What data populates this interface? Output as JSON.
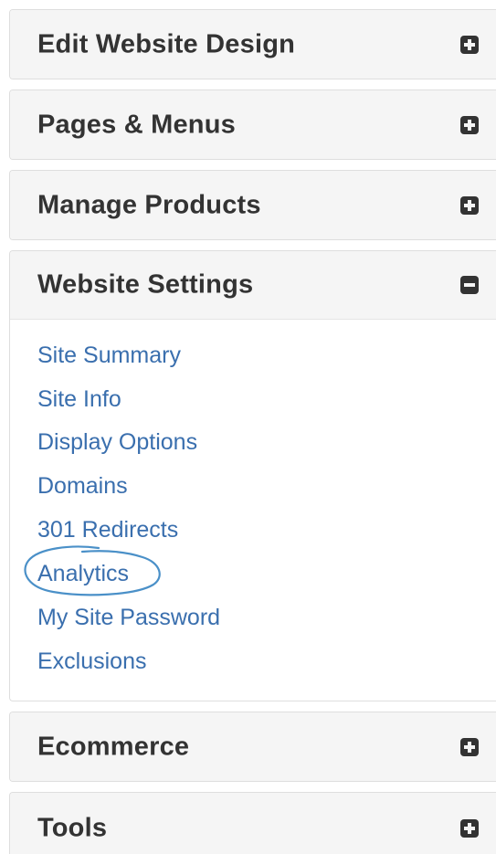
{
  "sections": [
    {
      "title": "Edit Website Design",
      "state": "collapsed",
      "icon": "plus-square-icon"
    },
    {
      "title": "Pages & Menus",
      "state": "collapsed",
      "icon": "plus-square-icon"
    },
    {
      "title": "Manage Products",
      "state": "collapsed",
      "icon": "plus-square-icon"
    },
    {
      "title": "Website Settings",
      "state": "expanded",
      "icon": "minus-square-icon",
      "links": [
        "Site Summary",
        "Site Info",
        "Display Options",
        "Domains",
        "301 Redirects",
        "Analytics",
        "My Site Password",
        "Exclusions"
      ]
    },
    {
      "title": "Ecommerce",
      "state": "collapsed",
      "icon": "plus-square-icon"
    },
    {
      "title": "Tools",
      "state": "collapsed",
      "icon": "plus-square-icon"
    }
  ],
  "annotation": {
    "highlighted_link": "Analytics",
    "color": "#4a90c8"
  },
  "colors": {
    "heading_bg": "#f5f5f5",
    "heading_text": "#333333",
    "link": "#3a6fae",
    "border": "#dedede"
  }
}
